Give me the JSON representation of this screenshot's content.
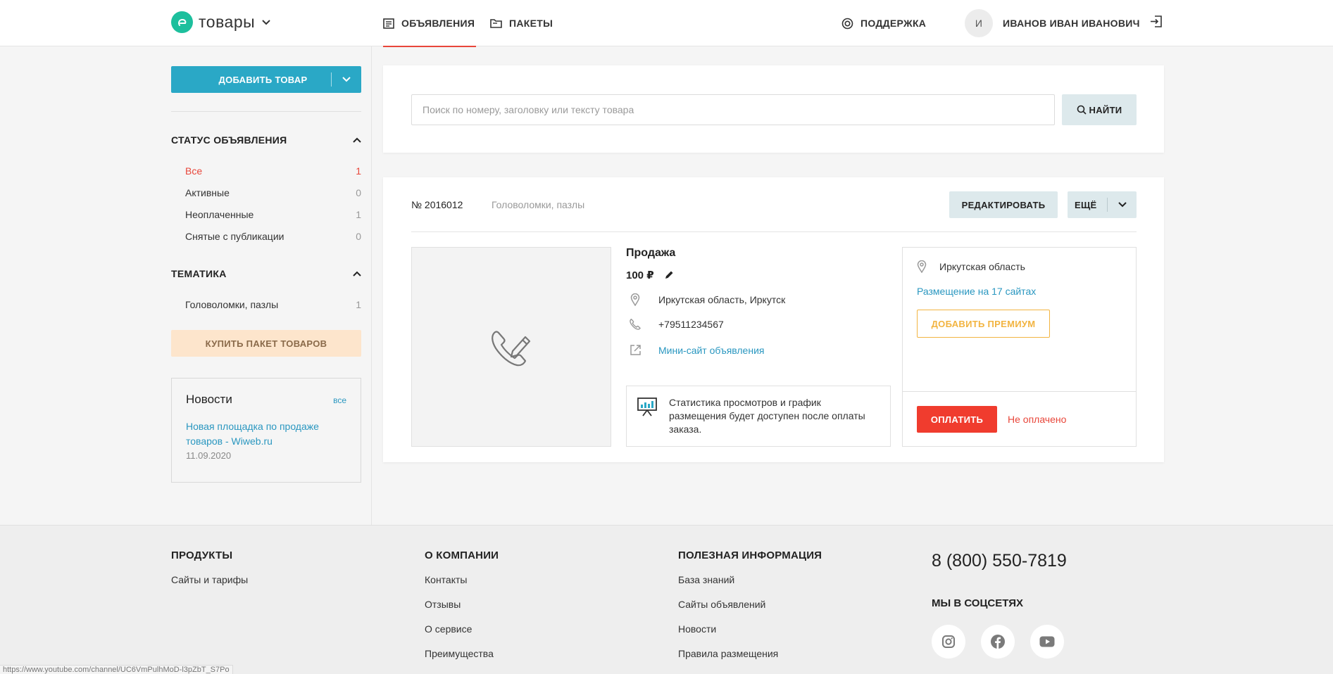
{
  "header": {
    "logo_text": "товары",
    "nav": [
      {
        "label": "ОБЪЯВЛЕНИЯ",
        "icon": "listing-icon",
        "active": true
      },
      {
        "label": "ПАКЕТЫ",
        "icon": "folder-icon",
        "active": false
      }
    ],
    "support_label": "ПОДДЕРЖКА",
    "user_initial": "И",
    "user_name": "ИВАНОВ ИВАН ИВАНОВИЧ"
  },
  "sidebar": {
    "add_button": "ДОБАВИТЬ ТОВАР",
    "status_title": "СТАТУС ОБЪЯВЛЕНИЯ",
    "status_filters": [
      {
        "label": "Все",
        "count": "1"
      },
      {
        "label": "Активные",
        "count": "0"
      },
      {
        "label": "Неоплаченные",
        "count": "1"
      },
      {
        "label": "Снятые с публикации",
        "count": "0"
      }
    ],
    "topic_title": "ТЕМАТИКА",
    "topic_filters": [
      {
        "label": "Головоломки, пазлы",
        "count": "1"
      }
    ],
    "buy_pack": "КУПИТЬ ПАКЕТ ТОВАРОВ",
    "news": {
      "title": "Новости",
      "all_link": "все",
      "item_title": "Новая площадка по продаже товаров - Wiweb.ru",
      "item_date": "11.09.2020"
    }
  },
  "search": {
    "placeholder": "Поиск по номеру, заголовку или тексту товара",
    "button": "НАЙТИ"
  },
  "listing": {
    "number": "№ 2016012",
    "category": "Головоломки, пазлы",
    "edit_button": "РЕДАКТИРОВАТЬ",
    "more_button": "ЕЩЁ",
    "deal_type": "Продажа",
    "price": "100 ₽",
    "location": "Иркутская область, Иркутск",
    "phone": "+79511234567",
    "mini_site": "Мини-сайт объявления",
    "stats_text": "Статистика просмотров и график размещения будет доступен после оплаты заказа.",
    "region": "Иркутская область",
    "placement": "Размещение на 17 сайтах",
    "premium_button": "ДОБАВИТЬ ПРЕМИУМ",
    "pay_button": "ОПЛАТИТЬ",
    "pay_status": "Не оплачено"
  },
  "footer": {
    "products": {
      "title": "ПРОДУКТЫ",
      "links": [
        "Сайты и тарифы"
      ]
    },
    "company": {
      "title": "О КОМПАНИИ",
      "links": [
        "Контакты",
        "Отзывы",
        "О сервисе",
        "Преимущества"
      ]
    },
    "info": {
      "title": "ПОЛЕЗНАЯ ИНФОРМАЦИЯ",
      "links": [
        "База знаний",
        "Сайты объявлений",
        "Новости",
        "Правила размещения"
      ]
    },
    "phone": "8 (800) 550-7819",
    "social_title": "МЫ В СОЦСЕТЯХ",
    "social_icons": [
      "instagram-icon",
      "facebook-icon",
      "youtube-icon"
    ]
  },
  "statusbar_url": "https://www.youtube.com/channel/UC6VmPulhMoD-l3pZbT_S7Po",
  "colors": {
    "accent_red": "#e8463a",
    "primary_blue": "#2aa8c6",
    "link_blue": "#2a97c0",
    "premium_yellow": "#f2b441",
    "logo_green": "#1dbf9d",
    "pay_red": "#f03c2e"
  }
}
